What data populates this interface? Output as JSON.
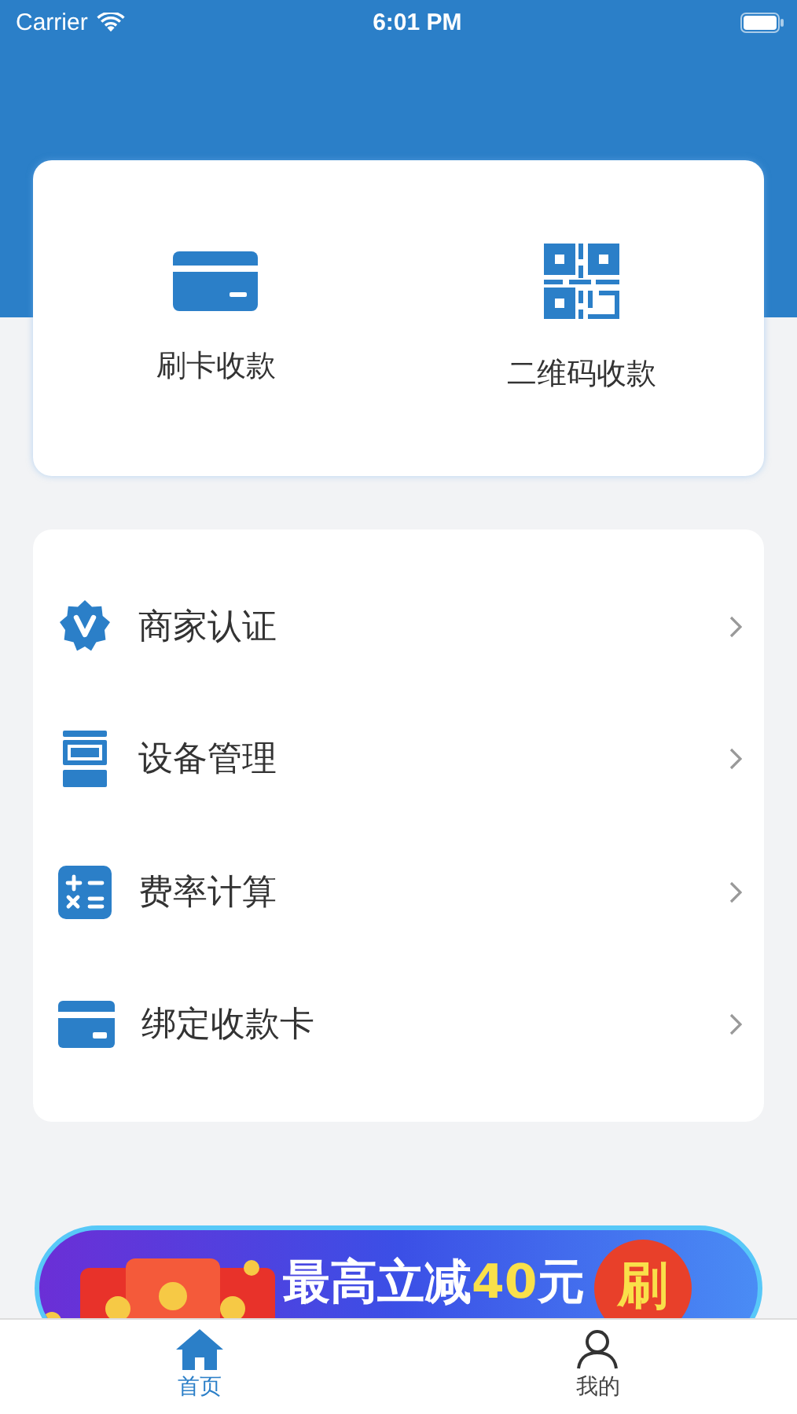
{
  "status_bar": {
    "carrier": "Carrier",
    "time": "6:01 PM"
  },
  "quick_actions": [
    {
      "kind": "card",
      "label": "刷卡收款"
    },
    {
      "kind": "qr",
      "label": "二维码收款"
    }
  ],
  "menu": [
    {
      "kind": "badge",
      "label": "商家认证"
    },
    {
      "kind": "pos",
      "label": "设备管理"
    },
    {
      "kind": "calculator",
      "label": "费率计算"
    },
    {
      "kind": "card",
      "label": "绑定收款卡"
    }
  ],
  "banner": {
    "segments": [
      {
        "text": "最高立减",
        "highlight": false
      },
      {
        "text": "40",
        "highlight": true
      },
      {
        "text": "元",
        "highlight": false
      }
    ],
    "button": "刷"
  },
  "tab_bar": [
    {
      "kind": "home",
      "label": "首页",
      "selected": true
    },
    {
      "kind": "person",
      "label": "我的",
      "selected": false
    }
  ]
}
